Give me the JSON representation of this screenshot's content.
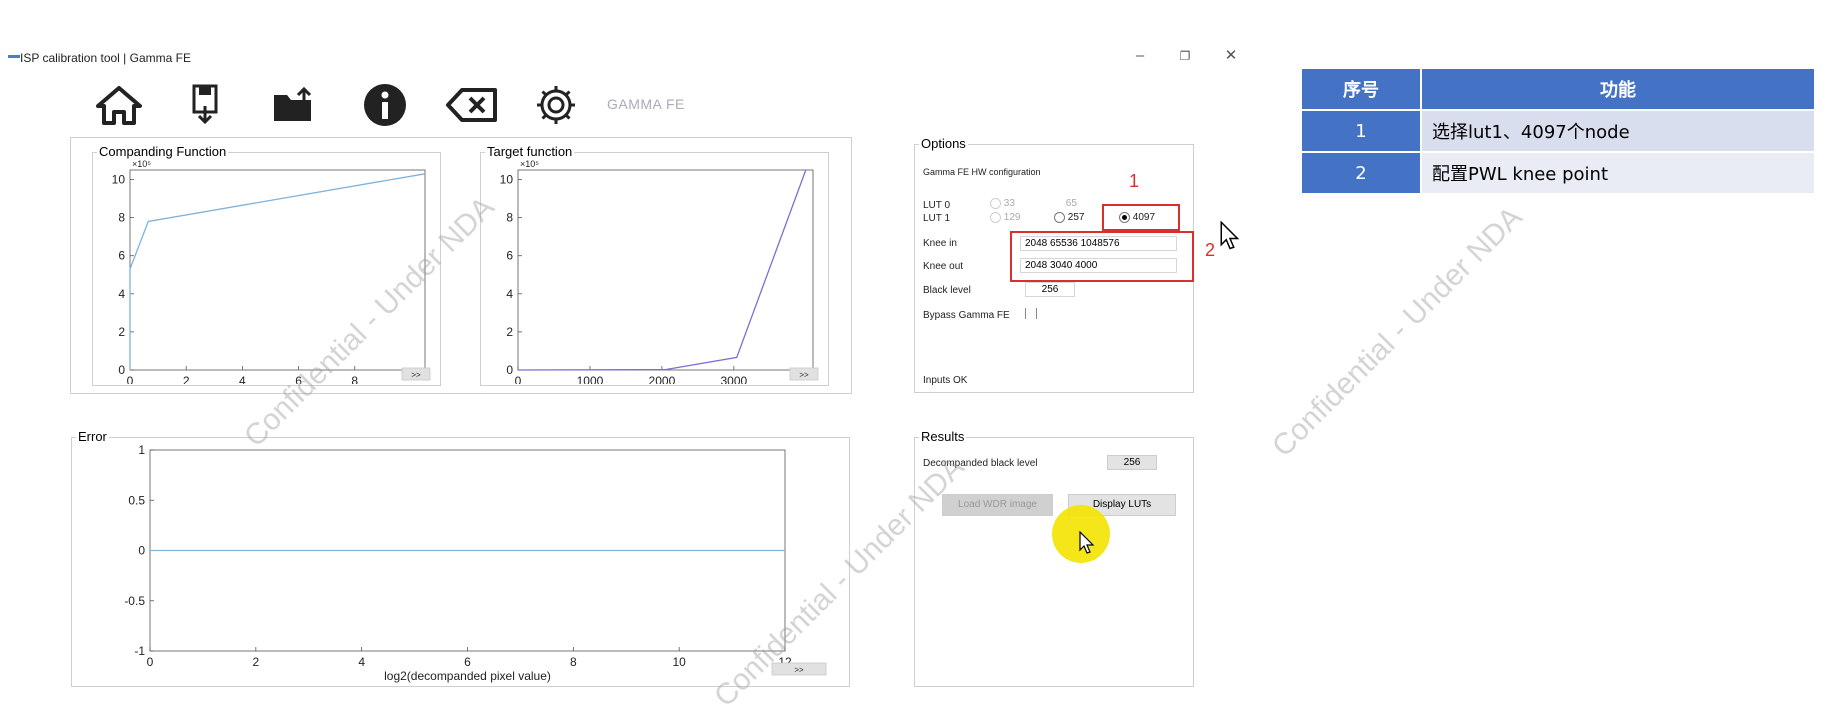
{
  "window": {
    "title": "ISP calibration tool | Gamma FE",
    "minimize_icon": "minimize-icon",
    "restore_icon": "restore-icon",
    "close_icon": "close-icon"
  },
  "toolbar": {
    "icons": [
      "home-icon",
      "save-icon",
      "open-folder-icon",
      "info-icon",
      "clear-icon",
      "settings-icon"
    ],
    "module_label": "GAMMA FE"
  },
  "companding": {
    "title": "Companding Function",
    "exp": "×10⁵",
    "next_label": ">>"
  },
  "target": {
    "title": "Target function",
    "exp": "×10⁵",
    "next_label": ">>"
  },
  "error": {
    "title": "Error",
    "xlabel": "log2(decompanded pixel value)",
    "next_label": ">>"
  },
  "options": {
    "title": "Options",
    "hw_config": "Gamma FE HW configuration",
    "lut0": "LUT 0",
    "lut1": "LUT 1",
    "r33": "33",
    "r65": "65",
    "r129": "129",
    "r257": "257",
    "r4097": "4097",
    "knee_in_label": "Knee in",
    "knee_in_value": "2048 65536 1048576",
    "knee_out_label": "Knee out",
    "knee_out_value": "2048 3040 4000",
    "black_level_label": "Black level",
    "black_level_value": "256",
    "bypass_label": "Bypass Gamma FE",
    "status": "Inputs OK"
  },
  "results": {
    "title": "Results",
    "decomp_label": "Decompanded black level",
    "decomp_value": "256",
    "load_btn": "Load WDR image",
    "display_btn": "Display LUTs"
  },
  "annotations": {
    "one": "1",
    "two": "2"
  },
  "legend_table": {
    "headers": [
      "序号",
      "功能"
    ],
    "rows": [
      {
        "num": "1",
        "text": "选择lut1、4097个node"
      },
      {
        "num": "2",
        "text": "配置PWL knee point"
      }
    ]
  },
  "watermark": "Confidential - Under NDA",
  "colors": {
    "curve_blue": "#7fb2d8",
    "curve_purple": "#7a6fd6",
    "header_blue": "#4472c4",
    "annotation_red": "#d9302c",
    "cursor_highlight": "#f4e300"
  },
  "chart_data": [
    {
      "type": "line",
      "title": "Companding Function",
      "xlabel": "",
      "ylabel": "",
      "xlim": [
        0,
        10.5
      ],
      "ylim": [
        0,
        10.5
      ],
      "x_ticks": [
        0,
        2,
        4,
        6,
        8
      ],
      "y_ticks": [
        0,
        2,
        4,
        6,
        8,
        10
      ],
      "y_multiplier": "×10⁵",
      "series": [
        {
          "x": [
            0,
            0,
            0.65,
            10.5
          ],
          "y": [
            0,
            5.3,
            7.8,
            10.3
          ]
        }
      ]
    },
    {
      "type": "line",
      "title": "Target function",
      "xlabel": "",
      "ylabel": "",
      "xlim": [
        0,
        4100
      ],
      "ylim": [
        0,
        10.5
      ],
      "x_ticks": [
        0,
        1000,
        2000,
        3000
      ],
      "y_ticks": [
        0,
        2,
        4,
        6,
        8,
        10
      ],
      "y_multiplier": "×10⁵",
      "series": [
        {
          "x": [
            0,
            2048,
            3040,
            4000
          ],
          "y": [
            0,
            0.02,
            0.66,
            10.5
          ]
        }
      ]
    },
    {
      "type": "line",
      "title": "Error",
      "xlabel": "log2(decompanded pixel value)",
      "ylabel": "",
      "xlim": [
        0,
        12
      ],
      "ylim": [
        -1,
        1
      ],
      "x_ticks": [
        0,
        2,
        4,
        6,
        8,
        10,
        12
      ],
      "y_ticks": [
        -1,
        -0.5,
        0,
        0.5,
        1
      ],
      "series": [
        {
          "x": [
            0,
            12
          ],
          "y": [
            0,
            0
          ]
        }
      ]
    }
  ]
}
